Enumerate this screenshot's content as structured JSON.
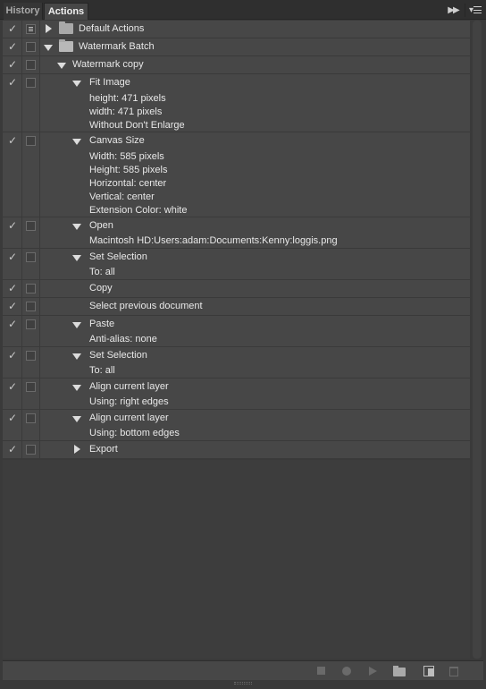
{
  "tabs": {
    "history": "History",
    "actions": "Actions"
  },
  "panel_icons": {
    "collapse": "double-chevron-right-icon",
    "menu": "panel-menu-icon"
  },
  "rows": [
    {
      "label": "Default Actions",
      "params": []
    },
    {
      "label": "Watermark Batch",
      "params": []
    },
    {
      "label": "Watermark copy",
      "params": []
    },
    {
      "label": "Fit Image",
      "params": [
        "height: 471 pixels",
        "width: 471 pixels",
        "Without Don't Enlarge"
      ]
    },
    {
      "label": "Canvas Size",
      "params": [
        "Width: 585 pixels",
        "Height: 585 pixels",
        "Horizontal: center",
        "Vertical: center",
        "Extension Color: white"
      ]
    },
    {
      "label": "Open",
      "params": [
        "Macintosh HD:Users:adam:Documents:Kenny:loggis.png"
      ]
    },
    {
      "label": "Set Selection",
      "params": [
        "To: all"
      ]
    },
    {
      "label": "Copy",
      "params": []
    },
    {
      "label": "Select previous document",
      "params": []
    },
    {
      "label": "Paste",
      "params": [
        "Anti-alias: none"
      ]
    },
    {
      "label": "Set Selection",
      "params": [
        "To: all"
      ]
    },
    {
      "label": "Align current layer",
      "params": [
        "Using: right edges"
      ]
    },
    {
      "label": "Align current layer",
      "params": [
        "Using: bottom edges"
      ]
    },
    {
      "label": "Export",
      "params": []
    }
  ],
  "toolbar": {
    "stop": "stop-icon",
    "record": "record-icon",
    "play": "play-icon",
    "new_set": "new-set-folder-icon",
    "new_action": "new-action-icon",
    "delete": "trash-icon"
  },
  "colors": {
    "panel_bg": "#474747",
    "tabbar_bg": "#2f2f2f",
    "text": "#e8e8e8"
  }
}
